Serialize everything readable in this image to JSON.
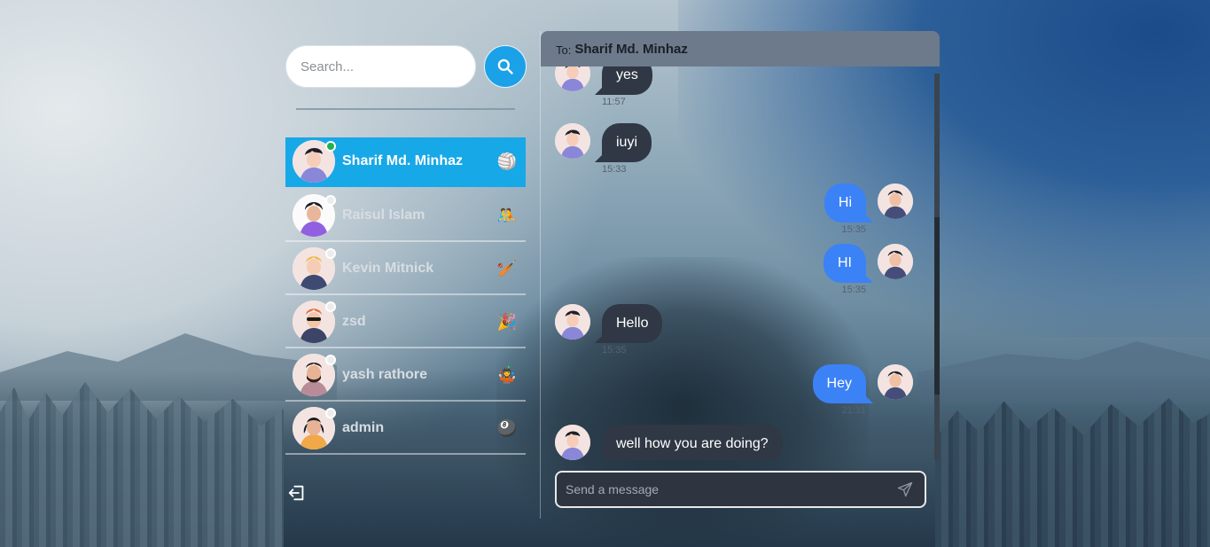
{
  "search": {
    "placeholder": "Search..."
  },
  "contacts": [
    {
      "name": "Sharif Md. Minhaz",
      "status": "online",
      "emoji": "🏐",
      "active": true
    },
    {
      "name": "Raisul Islam",
      "status": "offline",
      "emoji": "🤼",
      "active": false
    },
    {
      "name": "Kevin Mitnick",
      "status": "offline",
      "emoji": "🏏",
      "active": false
    },
    {
      "name": "zsd",
      "status": "offline",
      "emoji": "🎉",
      "active": false
    },
    {
      "name": "yash rathore",
      "status": "offline",
      "emoji": "🤹",
      "active": false
    },
    {
      "name": "admin",
      "status": "offline",
      "emoji": "🎱",
      "active": false
    }
  ],
  "chat": {
    "to_label": "To:",
    "to_name": "Sharif Md. Minhaz",
    "messages": [
      {
        "dir": "in",
        "text": "yes",
        "time": "11:57"
      },
      {
        "dir": "in",
        "text": "iuyi",
        "time": "15:33"
      },
      {
        "dir": "out",
        "text": "Hi",
        "time": "15:35"
      },
      {
        "dir": "out",
        "text": "HI",
        "time": "15:35"
      },
      {
        "dir": "in",
        "text": "Hello",
        "time": "15:35"
      },
      {
        "dir": "out",
        "text": "Hey",
        "time": "21:31"
      },
      {
        "dir": "in",
        "text": "well how you are doing?",
        "time": ""
      }
    ],
    "composer_placeholder": "Send a message"
  },
  "colors": {
    "accent": "#17a8e8",
    "online": "#22b14c",
    "outgoing_bubble": "#3b82f6",
    "incoming_bubble": "#2f3844",
    "header": "#6d7a8b"
  },
  "icons": {
    "search": "search-icon",
    "logout": "logout-icon",
    "send": "send-icon"
  }
}
